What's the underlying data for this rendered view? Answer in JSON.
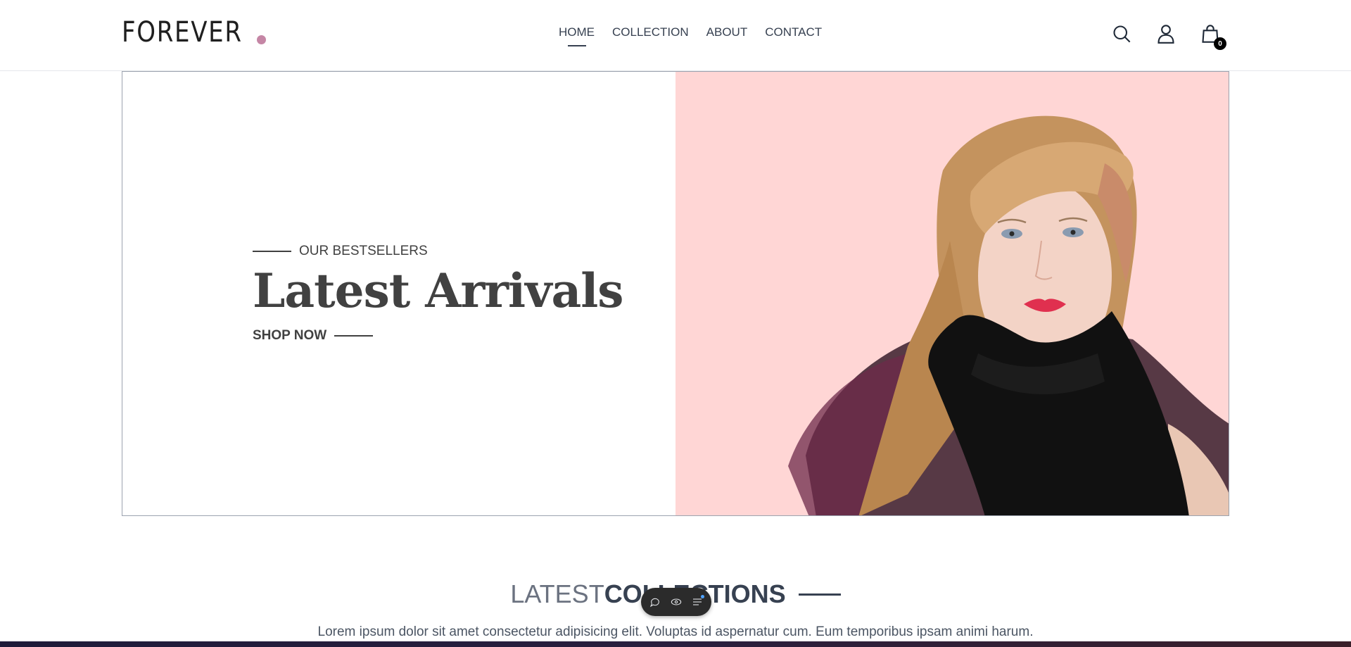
{
  "brand": {
    "logo_text": "FOREVER",
    "dot_color": "#c586a5"
  },
  "nav": {
    "items": [
      {
        "label": "HOME",
        "active": true
      },
      {
        "label": "COLLECTION",
        "active": false
      },
      {
        "label": "ABOUT",
        "active": false
      },
      {
        "label": "CONTACT",
        "active": false
      }
    ]
  },
  "header_icons": {
    "search": "search-icon",
    "profile": "user-icon",
    "cart": "shopping-bag-icon",
    "cart_count": "0"
  },
  "hero": {
    "tag": "OUR BESTSELLERS",
    "title": "Latest Arrivals",
    "cta": "SHOP NOW",
    "image_bg_color": "#ffd6d5"
  },
  "latest": {
    "title_light": "LATEST",
    "title_bold": "COLLECTIONS",
    "description": "Lorem ipsum dolor sit amet consectetur adipisicing elit. Voluptas id aspernatur cum. Eum temporibus ipsam animi harum."
  },
  "floating_toolbar": {
    "icons": [
      "chat-icon",
      "eye-icon",
      "list-icon"
    ]
  }
}
